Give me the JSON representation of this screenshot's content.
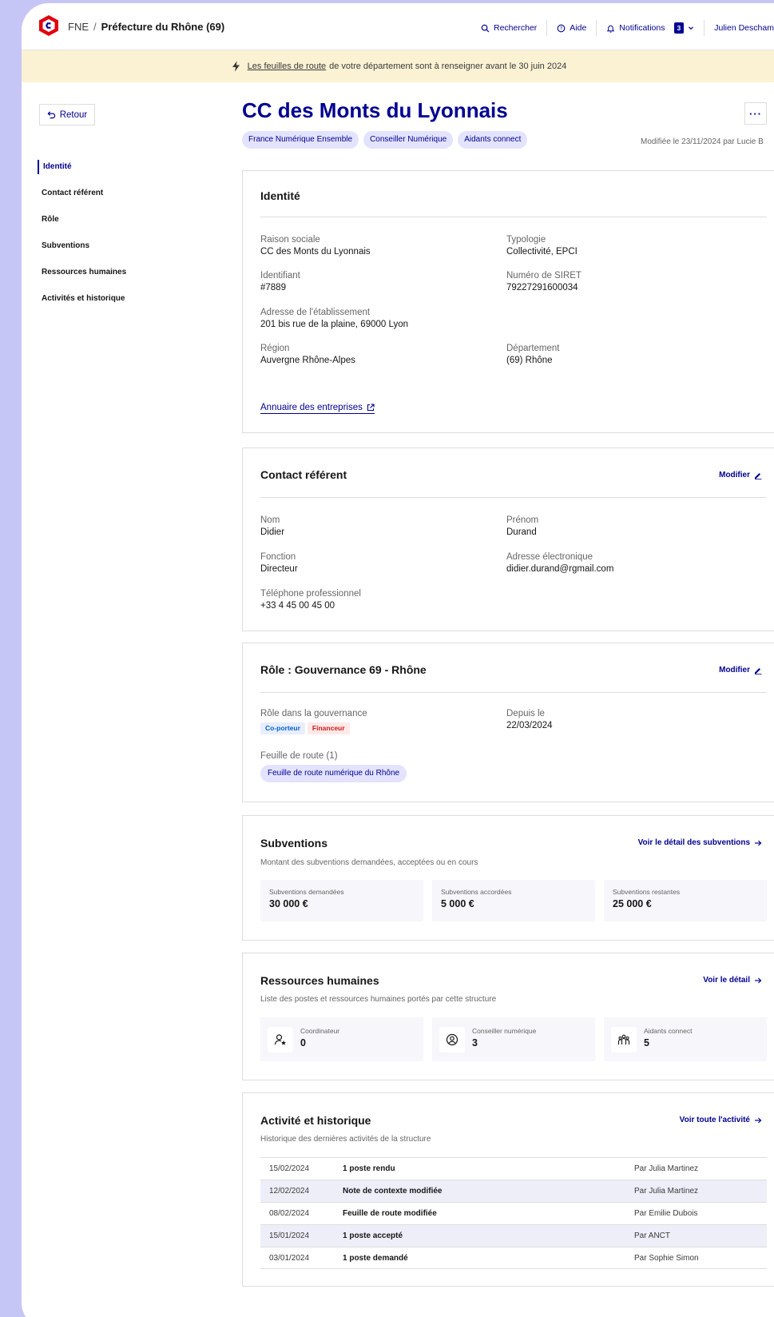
{
  "header": {
    "brand": "FNE",
    "separator": "/",
    "org": "Préfecture du Rhône (69)",
    "nav": {
      "search": "Rechercher",
      "help": "Aide",
      "notifications": "Notifications",
      "notif_count": "3",
      "user": "Julien Deschamps"
    }
  },
  "banner": {
    "link": "Les feuilles de route",
    "text": "de votre département sont à renseigner avant le 30 juin 2024"
  },
  "sidebar": {
    "back": "Retour",
    "items": [
      {
        "label": "Identité"
      },
      {
        "label": "Contact référent"
      },
      {
        "label": "Rôle"
      },
      {
        "label": "Subventions"
      },
      {
        "label": "Ressources humaines"
      },
      {
        "label": "Activités et historique"
      }
    ]
  },
  "page": {
    "title": "CC des Monts du Lyonnais",
    "tags": [
      "France Numérique Ensemble",
      "Conseiller Numérique",
      "Aidants connect"
    ],
    "modified": "Modifiée le 23/11/2024 par Lucie B",
    "more": "···"
  },
  "identite": {
    "title": "Identité",
    "raison_label": "Raison sociale",
    "raison": "CC des Monts du Lyonnais",
    "typo_label": "Typologie",
    "typo": "Collectivité, EPCI",
    "id_label": "Identifiant",
    "id": "#7889",
    "siret_label": "Numéro de SIRET",
    "siret": "79227291600034",
    "addr_label": "Adresse de l'établissement",
    "addr": "201 bis rue de la plaine, 69000 Lyon",
    "region_label": "Région",
    "region": "Auvergne Rhône-Alpes",
    "dept_label": "Département",
    "dept": "(69) Rhône",
    "link": "Annuaire des entreprises"
  },
  "contact": {
    "title": "Contact référent",
    "edit": "Modifier",
    "nom_label": "Nom",
    "nom": "Didier",
    "prenom_label": "Prénom",
    "prenom": "Durand",
    "fonction_label": "Fonction",
    "fonction": "Directeur",
    "email_label": "Adresse électronique",
    "email": "didier.durand@rgmail.com",
    "tel_label": "Téléphone professionnel",
    "tel": "+33 4 45 00 45 00"
  },
  "role": {
    "title": "Rôle : Gouvernance 69 - Rhône",
    "edit": "Modifier",
    "gov_label": "Rôle dans la gouvernance",
    "pills": [
      "Co-porteur",
      "Financeur"
    ],
    "since_label": "Depuis le",
    "since": "22/03/2024",
    "fdr_label": "Feuille de route (1)",
    "fdr": "Feuille de route numérique du Rhône"
  },
  "subventions": {
    "title": "Subventions",
    "link": "Voir le détail des subventions",
    "subtitle": "Montant des subventions demandées, acceptées ou en cours",
    "tiles": [
      {
        "label": "Subventions demandées",
        "value": "30 000 €"
      },
      {
        "label": "Subventions accordées",
        "value": "5 000 €"
      },
      {
        "label": "Subventions restantes",
        "value": "25 000 €"
      }
    ]
  },
  "rh": {
    "title": "Ressources humaines",
    "link": "Voir le détail",
    "subtitle": "Liste des postes et ressources humaines portés par cette structure",
    "tiles": [
      {
        "label": "Coordinateur",
        "value": "0",
        "icon": "user-star-icon"
      },
      {
        "label": "Conseiller numérique",
        "value": "3",
        "icon": "user-circle-icon"
      },
      {
        "label": "Aidants connect",
        "value": "5",
        "icon": "group-icon"
      }
    ]
  },
  "activite": {
    "title": "Activité et historique",
    "link": "Voir toute l'activité",
    "subtitle": "Historique des dernières activités de la structure",
    "rows": [
      {
        "date": "15/02/2024",
        "action": "1 poste rendu",
        "by": "Par Julia Martinez"
      },
      {
        "date": "12/02/2024",
        "action": "Note de contexte modifiée",
        "by": "Par Julia Martinez"
      },
      {
        "date": "08/02/2024",
        "action": "Feuille de route modifiée",
        "by": "Par Emilie Dubois"
      },
      {
        "date": "15/01/2024",
        "action": "1 poste accepté",
        "by": "Par ANCT"
      },
      {
        "date": "03/01/2024",
        "action": "1 poste demandé",
        "by": "Par Sophie Simon"
      }
    ]
  },
  "colors": {
    "accent": "#000091",
    "banner": "#fbf1d3",
    "tag_bg": "#e3e3fd",
    "backdrop": "#c6c6f6"
  }
}
